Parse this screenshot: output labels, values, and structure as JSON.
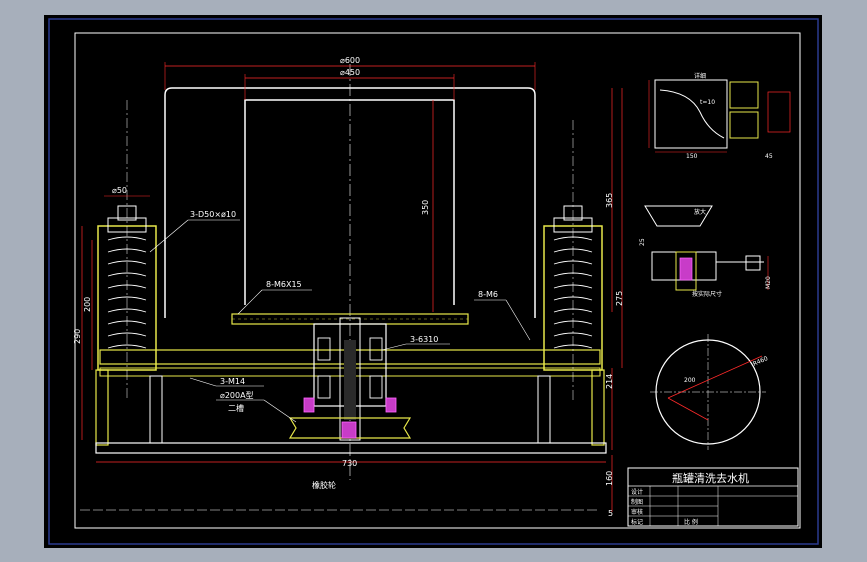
{
  "drawing": {
    "title": "瓶罐清洗去水机",
    "labels": {
      "d600": "⌀600",
      "d450": "⌀450",
      "d50": "⌀50",
      "spring": "3-D50×ø10",
      "m6x15": "8-M6X15",
      "m6": "8-M6",
      "m14": "3-M14",
      "bearing": "3-6310",
      "pulley": "⌀200A型",
      "pulley2": "二槽",
      "rubber": "橡胶轮",
      "d200": "200",
      "d290": "290",
      "d350": "350",
      "d365": "365",
      "d275": "275",
      "d214": "214",
      "d160": "160",
      "d730": "730",
      "d150": "150",
      "d5": "5",
      "detail_a": "详细",
      "t10": "t=10",
      "detail_b": "放大",
      "d25": "25",
      "d20": "M20",
      "note": "按实际尺寸",
      "r460": "R460",
      "d200b": "200",
      "d150b": "150",
      "d45": "45"
    },
    "title_block": {
      "rows": [
        "设计",
        "制图",
        "审核",
        "标记"
      ],
      "count": "比 例"
    }
  }
}
